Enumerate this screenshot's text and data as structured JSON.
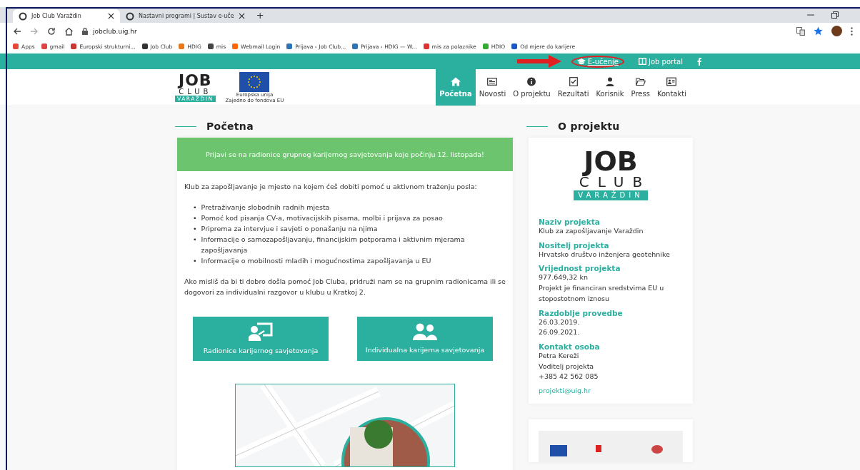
{
  "browser": {
    "tabs": [
      {
        "title": "Job Club Varaždin",
        "selected": true
      },
      {
        "title": "Nastavni programi | Sustav e-uče",
        "selected": false
      }
    ],
    "new_tab": "+",
    "url": "jobclub.uig.hr",
    "bookmarks": [
      "Apps",
      "gmail",
      "Europski strukturni...",
      "Job Club",
      "HDIG",
      "mis",
      "Webmail Login",
      "Prijava ‹ Job Club...",
      "Prijava ‹ HDIG — W...",
      "mis za polaznike",
      "HDIO",
      "Od mjere do karijere"
    ]
  },
  "topbar": {
    "links": [
      {
        "label": "E-učenje",
        "highlighted": true
      },
      {
        "label": "Job portal",
        "highlighted": false
      }
    ]
  },
  "logo": {
    "line1": "JOB",
    "line2": "CLUB",
    "line3": "VARAŽDIN",
    "eu_caption1": "Europska unija",
    "eu_caption2": "Zajedno do fondova EU"
  },
  "nav": [
    {
      "label": "Početna",
      "selected": true
    },
    {
      "label": "Novosti",
      "selected": false
    },
    {
      "label": "O projektu",
      "selected": false
    },
    {
      "label": "Rezultati",
      "selected": false
    },
    {
      "label": "Korisnik",
      "selected": false
    },
    {
      "label": "Press",
      "selected": false
    },
    {
      "label": "Kontakti",
      "selected": false
    }
  ],
  "main": {
    "heading": "Početna",
    "banner": "Prijavi se na radionice grupnog karijernog savjetovanja koje počinju 12. listopada!",
    "intro": "Klub za zapošljavanje je mjesto na kojem ćeš dobiti pomoć u aktivnom traženju posla:",
    "bullets": [
      {
        "marker": "•",
        "text": "Pretraživanje slobodnih radnih mjesta"
      },
      {
        "marker": "•",
        "text": "Pomoć kod pisanja CV-a, motivacijskih pisama, molbi i prijava za posao"
      },
      {
        "marker": "•",
        "text": "Priprema za intervjue i savjeti o ponašanju na njima"
      },
      {
        "marker": "•",
        "text": "Informacije o samozapošljavanju, financijskim potporama i aktivnim mjerama zapošljavanja"
      },
      {
        "marker": "•",
        "text": "Informacije o mobilnosti mladih i mogućnostima zapošljavanja u EU"
      }
    ],
    "outro": "Ako misliš da bi ti dobro došla pomoć Job Cluba, pridruži nam se na grupnim radionicama ili se dogovori za individualni razgovor u klubu u Kratkoj 2.",
    "buttons": [
      {
        "kind": "workshop",
        "label": "Radionice karijernog savjetovanja"
      },
      {
        "kind": "individual",
        "label": "Individualna karijerna savjetovanja"
      }
    ]
  },
  "sidebar": {
    "heading": "O projektu",
    "logo": {
      "line1": "JOB",
      "line2": "CLUB",
      "line3": "VARAŽDIN"
    },
    "sections": [
      {
        "title": "Naziv projekta",
        "lines": [
          "Klub za zapošljavanje Varaždin"
        ]
      },
      {
        "title": "Nositelj projekta",
        "lines": [
          "Hrvatsko društvo inženjera geotehnike"
        ]
      },
      {
        "title": "Vrijednost projekta",
        "lines": [
          "977.649,32 kn",
          "Projekt je financiran sredstvima EU u stopostotnom iznosu"
        ]
      },
      {
        "title": "Razdoblje provedbe",
        "lines": [
          "26.03.2019.",
          "26.09.2021."
        ]
      },
      {
        "title": "Kontakt osoba",
        "lines": [
          "Petra Kereži",
          "Voditelj projekta",
          "+385 42 562 085"
        ],
        "email": "projekti@uig.hr"
      }
    ]
  }
}
